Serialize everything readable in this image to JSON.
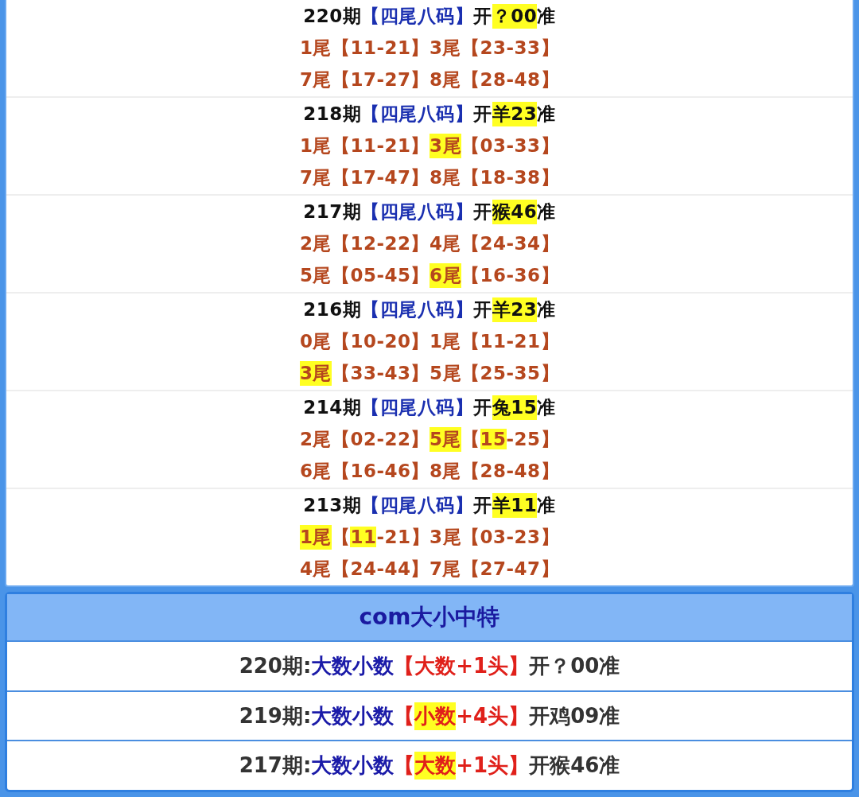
{
  "issues": [
    {
      "header": [
        {
          "text": "220期",
          "kind": "period",
          "highlighted": false
        },
        {
          "text": "【四尾八码】",
          "kind": "label",
          "highlighted": false
        },
        {
          "text": "开",
          "kind": "result",
          "highlighted": false
        },
        {
          "text": "？00",
          "kind": "result",
          "highlighted": true
        },
        {
          "text": "准",
          "kind": "result",
          "highlighted": false
        }
      ],
      "lines": [
        [
          {
            "text": "1尾【11-21】3尾【23-33】",
            "kind": "tail",
            "highlighted": false
          }
        ],
        [
          {
            "text": "7尾【17-27】8尾【28-48】",
            "kind": "tail",
            "highlighted": false
          }
        ]
      ]
    },
    {
      "header": [
        {
          "text": "218期",
          "kind": "period",
          "highlighted": false
        },
        {
          "text": "【四尾八码】",
          "kind": "label",
          "highlighted": false
        },
        {
          "text": "开",
          "kind": "result",
          "highlighted": false
        },
        {
          "text": "羊23",
          "kind": "result",
          "highlighted": true
        },
        {
          "text": "准",
          "kind": "result",
          "highlighted": false
        }
      ],
      "lines": [
        [
          {
            "text": "1尾【11-21】",
            "kind": "tail",
            "highlighted": false
          },
          {
            "text": "3尾",
            "kind": "tail",
            "highlighted": true
          },
          {
            "text": "【03-33】",
            "kind": "tail",
            "highlighted": false
          }
        ],
        [
          {
            "text": "7尾【17-47】8尾【18-38】",
            "kind": "tail",
            "highlighted": false
          }
        ]
      ]
    },
    {
      "header": [
        {
          "text": "217期",
          "kind": "period",
          "highlighted": false
        },
        {
          "text": "【四尾八码】",
          "kind": "label",
          "highlighted": false
        },
        {
          "text": "开",
          "kind": "result",
          "highlighted": false
        },
        {
          "text": "猴46",
          "kind": "result",
          "highlighted": true
        },
        {
          "text": "准",
          "kind": "result",
          "highlighted": false
        }
      ],
      "lines": [
        [
          {
            "text": "2尾【12-22】4尾【24-34】",
            "kind": "tail",
            "highlighted": false
          }
        ],
        [
          {
            "text": "5尾【05-45】",
            "kind": "tail",
            "highlighted": false
          },
          {
            "text": "6尾",
            "kind": "tail",
            "highlighted": true
          },
          {
            "text": "【16-36】",
            "kind": "tail",
            "highlighted": false
          }
        ]
      ]
    },
    {
      "header": [
        {
          "text": "216期",
          "kind": "period",
          "highlighted": false
        },
        {
          "text": "【四尾八码】",
          "kind": "label",
          "highlighted": false
        },
        {
          "text": "开",
          "kind": "result",
          "highlighted": false
        },
        {
          "text": "羊23",
          "kind": "result",
          "highlighted": true
        },
        {
          "text": "准",
          "kind": "result",
          "highlighted": false
        }
      ],
      "lines": [
        [
          {
            "text": "0尾【10-20】1尾【11-21】",
            "kind": "tail",
            "highlighted": false
          }
        ],
        [
          {
            "text": "3尾",
            "kind": "tail",
            "highlighted": true
          },
          {
            "text": "【33-43】5尾【25-35】",
            "kind": "tail",
            "highlighted": false
          }
        ]
      ]
    },
    {
      "header": [
        {
          "text": "214期",
          "kind": "period",
          "highlighted": false
        },
        {
          "text": "【四尾八码】",
          "kind": "label",
          "highlighted": false
        },
        {
          "text": "开",
          "kind": "result",
          "highlighted": false
        },
        {
          "text": "兔15",
          "kind": "result",
          "highlighted": true
        },
        {
          "text": "准",
          "kind": "result",
          "highlighted": false
        }
      ],
      "lines": [
        [
          {
            "text": "2尾【02-22】",
            "kind": "tail",
            "highlighted": false
          },
          {
            "text": "5尾",
            "kind": "tail",
            "highlighted": true
          },
          {
            "text": "【",
            "kind": "tail",
            "highlighted": false
          },
          {
            "text": "15",
            "kind": "tail",
            "highlighted": true
          },
          {
            "text": "-25】",
            "kind": "tail",
            "highlighted": false
          }
        ],
        [
          {
            "text": "6尾【16-46】8尾【28-48】",
            "kind": "tail",
            "highlighted": false
          }
        ]
      ]
    },
    {
      "header": [
        {
          "text": "213期",
          "kind": "period",
          "highlighted": false
        },
        {
          "text": "【四尾八码】",
          "kind": "label",
          "highlighted": false
        },
        {
          "text": "开",
          "kind": "result",
          "highlighted": false
        },
        {
          "text": "羊11",
          "kind": "result",
          "highlighted": true
        },
        {
          "text": "准",
          "kind": "result",
          "highlighted": false
        }
      ],
      "lines": [
        [
          {
            "text": "1尾",
            "kind": "tail",
            "highlighted": true
          },
          {
            "text": "【",
            "kind": "tail",
            "highlighted": false
          },
          {
            "text": "11",
            "kind": "tail",
            "highlighted": true
          },
          {
            "text": "-21】3尾【03-23】",
            "kind": "tail",
            "highlighted": false
          }
        ],
        [
          {
            "text": "4尾【24-44】7尾【27-47】",
            "kind": "tail",
            "highlighted": false
          }
        ]
      ]
    }
  ],
  "size_panel": {
    "title": "com大小中特",
    "rows": [
      {
        "period": "220期:",
        "label": "大数小数",
        "pick": [
          {
            "text": "【大数+1头】",
            "highlighted": false
          }
        ],
        "result": "开？00准"
      },
      {
        "period": "219期:",
        "label": "大数小数",
        "pick": [
          {
            "text": "【",
            "highlighted": false
          },
          {
            "text": "小数",
            "highlighted": true
          },
          {
            "text": "+4头】",
            "highlighted": false
          }
        ],
        "result": "开鸡09准"
      },
      {
        "period": "217期:",
        "label": "大数小数",
        "pick": [
          {
            "text": "【",
            "highlighted": false
          },
          {
            "text": "大数",
            "highlighted": true
          },
          {
            "text": "+1头】",
            "highlighted": false
          }
        ],
        "result": "开猴46准"
      }
    ]
  }
}
